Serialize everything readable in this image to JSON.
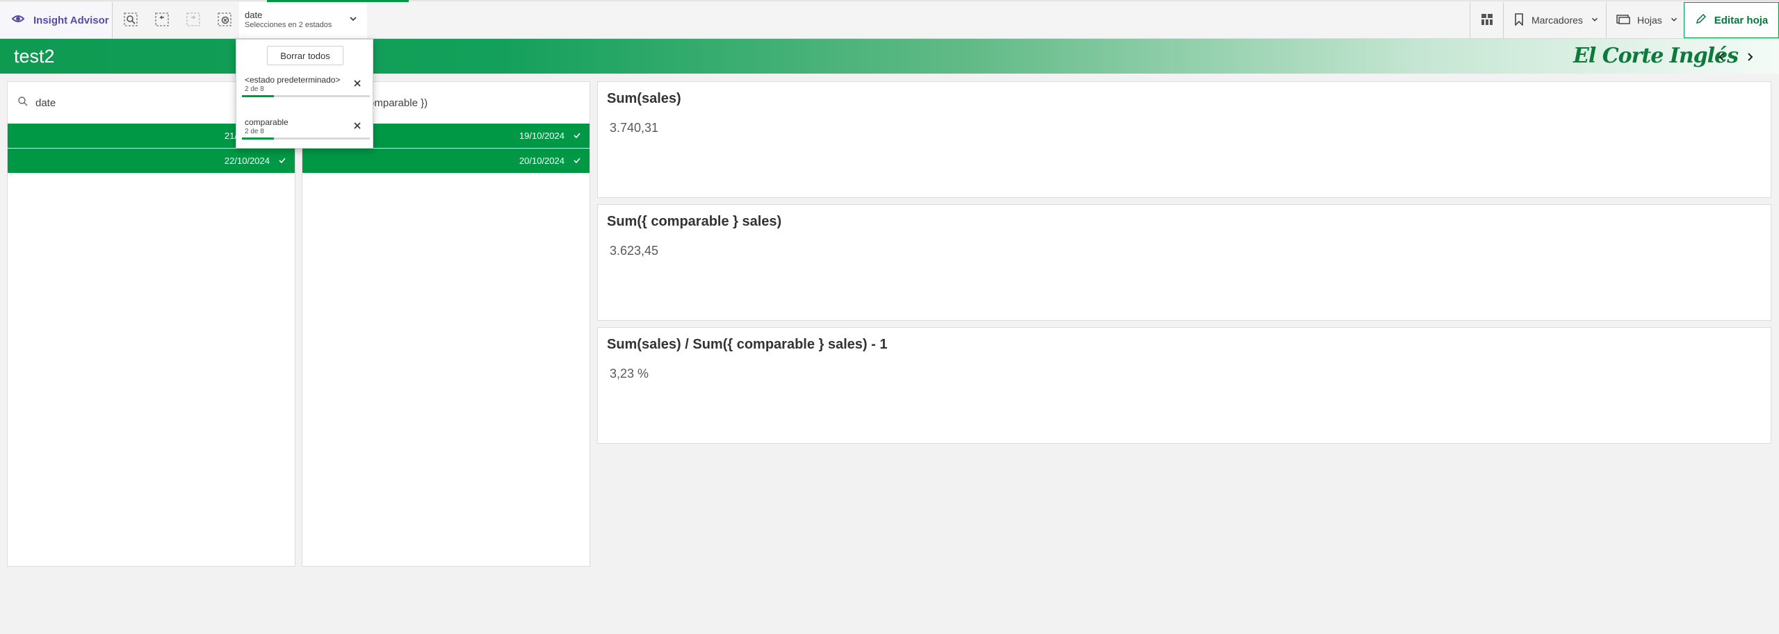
{
  "toolbar": {
    "insight_advisor": "Insight Advisor",
    "selection": {
      "field": "date",
      "summary": "Selecciones en 2 estados"
    },
    "bookmarks": "Marcadores",
    "sheets": "Hojas",
    "edit_sheet": "Editar hoja"
  },
  "header": {
    "title": "test2"
  },
  "colors": {
    "accent": "#009845",
    "insight": "#5a4aa5"
  },
  "popover": {
    "clear_all": "Borrar todos",
    "items": [
      {
        "name": "<estado predeterminado>",
        "count": "2 de 8",
        "progress": 0.25
      },
      {
        "name": "comparable",
        "count": "2 de 8",
        "progress": 0.25
      }
    ]
  },
  "filter_panes": [
    {
      "title": "date",
      "rows": [
        {
          "label": "21/10/2024"
        },
        {
          "label": "22/10/2024"
        }
      ]
    },
    {
      "title": "date ({ comparable })",
      "rows": [
        {
          "label": "19/10/2024"
        },
        {
          "label": "20/10/2024"
        }
      ]
    }
  ],
  "kpis": [
    {
      "title": "Sum(sales)",
      "value": "3.740,31"
    },
    {
      "title": "Sum({ comparable } sales)",
      "value": "3.623,45"
    },
    {
      "title": "Sum(sales) / Sum({ comparable } sales) - 1",
      "value": "3,23 %"
    }
  ]
}
